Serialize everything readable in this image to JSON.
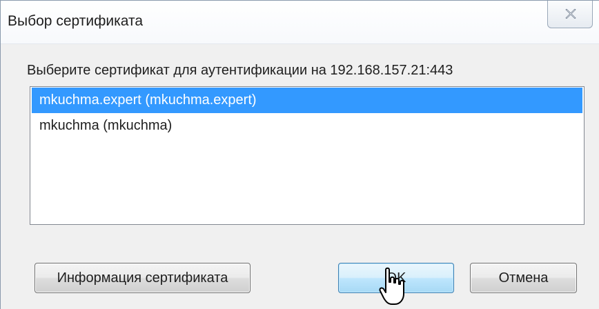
{
  "dialog": {
    "title": "Выбор сертификата",
    "prompt": "Выберите сертификат для аутентификации на 192.168.157.21:443"
  },
  "certificates": [
    {
      "label": "mkuchma.expert (mkuchma.expert)",
      "selected": true
    },
    {
      "label": "mkuchma (mkuchma)",
      "selected": false
    }
  ],
  "buttons": {
    "info_label": "Информация сертификата",
    "ok_label": "OK",
    "cancel_label": "Отмена"
  },
  "icons": {
    "close": "close-icon",
    "cursor": "hand-pointer-cursor"
  },
  "colors": {
    "selection": "#3399ff",
    "default_button_border": "#3c7fb1"
  }
}
